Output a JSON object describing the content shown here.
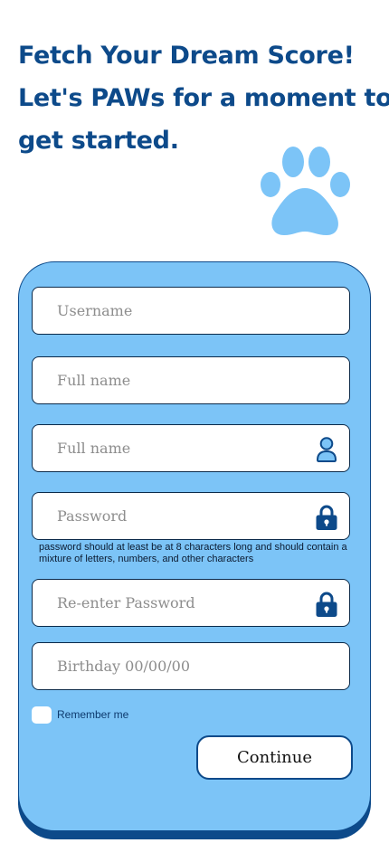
{
  "header": {
    "line1": "Fetch Your Dream Score!",
    "line2": "Let's PAWs for a moment to",
    "line3": "get started."
  },
  "form": {
    "username": {
      "placeholder": "Username",
      "value": ""
    },
    "full_name_1": {
      "placeholder": "Full name",
      "value": ""
    },
    "full_name_2": {
      "placeholder": "Full name",
      "value": "",
      "icon": "user-icon"
    },
    "password": {
      "placeholder": "Password",
      "value": "",
      "icon": "lock-icon"
    },
    "password_hint": "password should at least be at 8 characters long and should contain a mixture of letters, numbers, and other characters",
    "reenter_password": {
      "placeholder": "Re-enter Password",
      "value": "",
      "icon": "lock-icon"
    },
    "birthday": {
      "placeholder": "Birthday 00/00/00",
      "value": ""
    },
    "remember_label": "Remember me",
    "remember_checked": false,
    "continue_label": "Continue"
  },
  "colors": {
    "primary_navy": "#0d4a8a",
    "card_blue": "#7cc4f7",
    "paw_blue": "#7cc4f7",
    "field_background": "#ffffff"
  },
  "decor": {
    "icon": "paw-print-icon"
  }
}
